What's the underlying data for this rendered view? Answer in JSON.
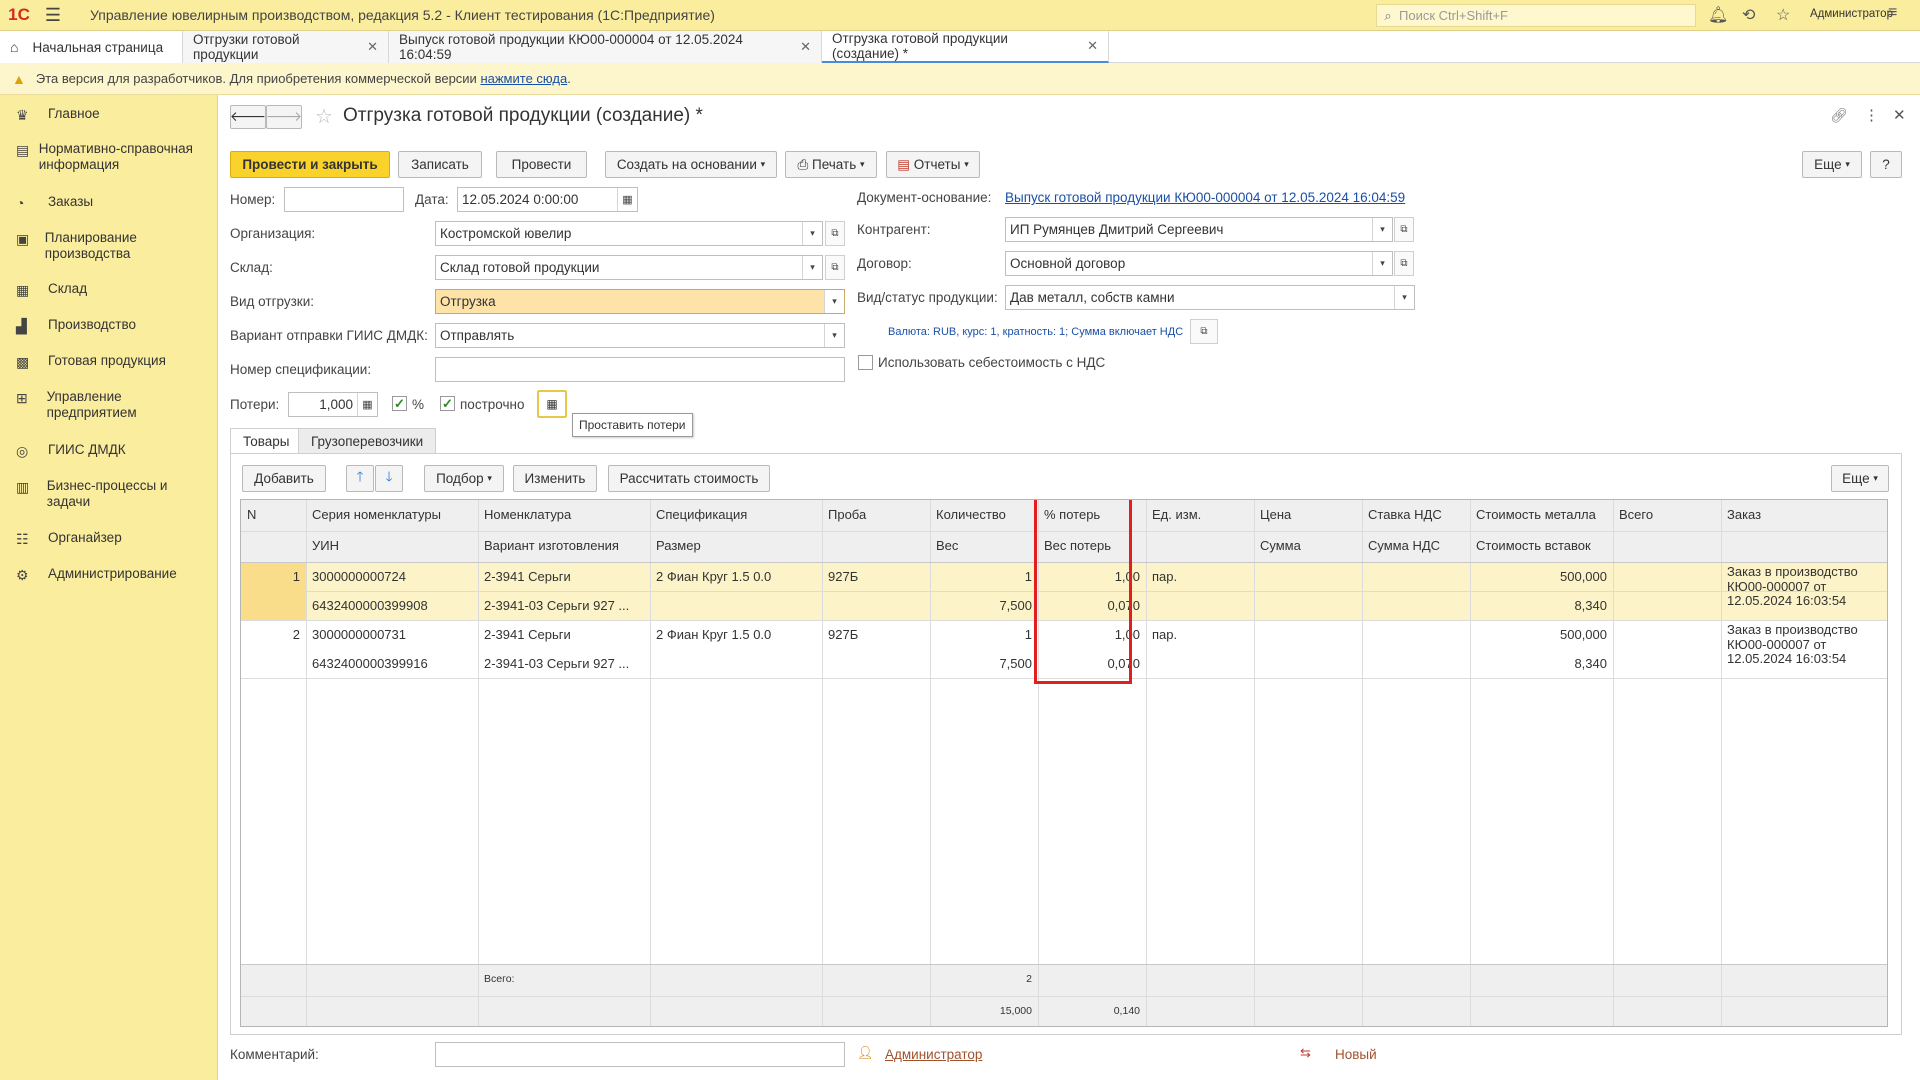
{
  "app": {
    "logo": "1С",
    "title": "Управление ювелирным производством, редакция 5.2  -  Клиент тестирования (1С:Предприятие)",
    "search_placeholder": "Поиск Ctrl+Shift+F",
    "user": "Администратор"
  },
  "tabs": [
    {
      "label": "Начальная страница"
    },
    {
      "label": "Отгрузки готовой продукции"
    },
    {
      "label": "Выпуск готовой продукции КЮ00-000004 от 12.05.2024 16:04:59"
    },
    {
      "label": "Отгрузка готовой продукции (создание) *"
    }
  ],
  "infobar": {
    "text": "Эта версия для разработчиков. Для приобретения коммерческой версии",
    "link": "нажмите сюда",
    "suffix": "."
  },
  "sidebar": {
    "items": [
      {
        "label": "Главное",
        "icon": "crown-icon"
      },
      {
        "label": "Нормативно-справочная информация",
        "icon": "book-icon"
      },
      {
        "label": "Заказы",
        "icon": "pie-icon"
      },
      {
        "label": "Планирование производства",
        "icon": "clipboard-icon"
      },
      {
        "label": "Склад",
        "icon": "grid-icon"
      },
      {
        "label": "Производство",
        "icon": "factory-icon"
      },
      {
        "label": "Готовая продукция",
        "icon": "box-icon"
      },
      {
        "label": "Управление предприятием",
        "icon": "org-icon"
      },
      {
        "label": "ГИИС ДМДК",
        "icon": "ring-icon"
      },
      {
        "label": "Бизнес-процессы и задачи",
        "icon": "tasks-icon"
      },
      {
        "label": "Органайзер",
        "icon": "organizer-icon"
      },
      {
        "label": "Администрирование",
        "icon": "gear-icon"
      }
    ]
  },
  "form": {
    "title": "Отгрузка готовой продукции (создание) *",
    "toolbar": {
      "post_close": "Провести и закрыть",
      "save": "Записать",
      "post": "Провести",
      "create_based": "Создать на основании",
      "print": "Печать",
      "reports": "Отчеты",
      "more": "Еще",
      "help": "?"
    },
    "fields": {
      "number_label": "Номер:",
      "number_value": "",
      "date_label": "Дата:",
      "date_value": "12.05.2024  0:00:00",
      "org_label": "Организация:",
      "org_value": "Костромской ювелир",
      "warehouse_label": "Склад:",
      "warehouse_value": "Склад готовой продукции",
      "ship_type_label": "Вид отгрузки:",
      "ship_type_value": "Отгрузка",
      "giis_label": "Вариант отправки ГИИС ДМДК:",
      "giis_value": "Отправлять",
      "spec_label": "Номер спецификации:",
      "spec_value": "",
      "losses_label": "Потери:",
      "losses_value": "1,000",
      "percent_label": "%",
      "row_by_row_label": "построчно",
      "tooltip": "Проставить потери",
      "basis_label": "Документ-основание:",
      "basis_value": "Выпуск готовой продукции КЮ00-000004 от 12.05.2024 16:04:59",
      "contractor_label": "Контрагент:",
      "contractor_value": "ИП Румянцев Дмитрий Сергеевич",
      "contract_label": "Договор:",
      "contract_value": "Основной договор",
      "status_label": "Вид/статус продукции:",
      "status_value": "Дав металл, собств камни",
      "currency_info": "Валюта: RUB, курс: 1, кратность: 1; Сумма включает НДС",
      "cost_vat_label": "Использовать себестоимость с НДС"
    },
    "subtabs": [
      "Товары",
      "Грузоперевозчики"
    ],
    "grid_toolbar": {
      "add": "Добавить",
      "selection": "Подбор",
      "change": "Изменить",
      "calc_cost": "Рассчитать стоимость",
      "more": "Еще"
    },
    "grid": {
      "head1": [
        "N",
        "Серия номенклатуры",
        "Номенклатура",
        "Спецификация",
        "Проба",
        "Количество",
        "% потерь",
        "Ед. изм.",
        "Цена",
        "Ставка НДС",
        "Стоимость металла",
        "Всего",
        "Заказ"
      ],
      "head2": [
        "",
        "УИН",
        "Вариант изготовления",
        "Размер",
        "",
        "Вес",
        "Вес потерь",
        "",
        "Сумма",
        "Сумма НДС",
        "Стоимость вставок",
        "",
        ""
      ],
      "rows": [
        {
          "n": "1",
          "series": "3000000000724",
          "uin": "6432400000399908",
          "nom": "2-3941 Серьги",
          "variant": "2-3941-03 Серьги 927 ...",
          "spec": "2 Фиан Круг 1.5 0.0",
          "size": "",
          "probe": "927Б",
          "qty": "1",
          "weight": "7,500",
          "loss_pct": "1,00",
          "loss_weight": "0,070",
          "unit": "пар.",
          "metal_cost": "500,000",
          "insert_cost": "8,340",
          "order": "Заказ в производство КЮ00-000007 от 12.05.2024 16:03:54"
        },
        {
          "n": "2",
          "series": "3000000000731",
          "uin": "6432400000399916",
          "nom": "2-3941 Серьги",
          "variant": "2-3941-03 Серьги 927 ...",
          "spec": "2 Фиан Круг 1.5 0.0",
          "size": "",
          "probe": "927Б",
          "qty": "1",
          "weight": "7,500",
          "loss_pct": "1,00",
          "loss_weight": "0,070",
          "unit": "пар.",
          "metal_cost": "500,000",
          "insert_cost": "8,340",
          "order": "Заказ в производство КЮ00-000007 от 12.05.2024 16:03:54"
        }
      ],
      "footer": {
        "total_label": "Всего:",
        "qty_total": "2",
        "weight_total": "15,000",
        "loss_total": "0,140"
      }
    },
    "comment_label": "Комментарий:",
    "comment_value": "",
    "author": "Администратор",
    "status_new": "Новый"
  },
  "colors": {
    "accent_yellow": "#f9d32c",
    "sidebar_bg": "#fbed9e",
    "highlight_red": "#e02020",
    "selected_row": "#fdf3c8",
    "link_blue": "#1a4fa8"
  }
}
